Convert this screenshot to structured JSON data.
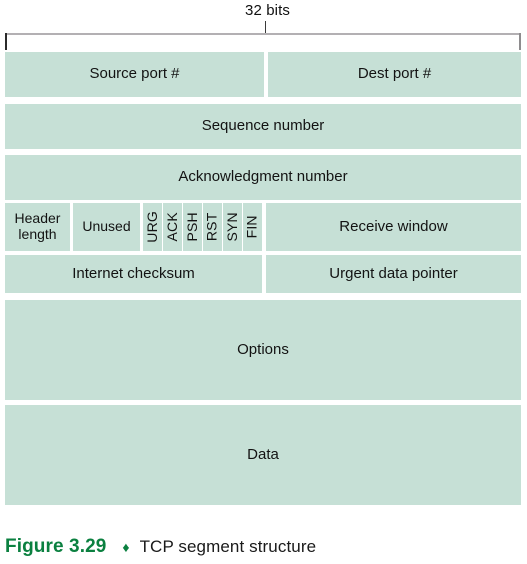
{
  "diagram": {
    "width_label": "32 bits",
    "rows": [
      {
        "name": "ports",
        "cells": [
          {
            "label": "Source port #"
          },
          {
            "label": "Dest port #"
          }
        ]
      },
      {
        "name": "sequence",
        "cells": [
          {
            "label": "Sequence number"
          }
        ]
      },
      {
        "name": "acknowledgment",
        "cells": [
          {
            "label": "Acknowledgment number"
          }
        ]
      },
      {
        "name": "flags",
        "cells": [
          {
            "label": "Header\nlength"
          },
          {
            "label": "Unused"
          },
          {
            "label": "URG"
          },
          {
            "label": "ACK"
          },
          {
            "label": "PSH"
          },
          {
            "label": "RST"
          },
          {
            "label": "SYN"
          },
          {
            "label": "FIN"
          },
          {
            "label": "Receive window"
          }
        ]
      },
      {
        "name": "checksum",
        "cells": [
          {
            "label": "Internet checksum"
          },
          {
            "label": "Urgent data pointer"
          }
        ]
      },
      {
        "name": "options",
        "cells": [
          {
            "label": "Options"
          }
        ]
      },
      {
        "name": "data",
        "cells": [
          {
            "label": "Data"
          }
        ]
      }
    ],
    "field_labels": {
      "source_port": "Source port #",
      "dest_port": "Dest port #",
      "sequence_number": "Sequence number",
      "acknowledgment_number": "Acknowledgment number",
      "header_length_line1": "Header",
      "header_length_line2": "length",
      "unused": "Unused",
      "flag_urg": "URG",
      "flag_ack": "ACK",
      "flag_psh": "PSH",
      "flag_rst": "RST",
      "flag_syn": "SYN",
      "flag_fin": "FIN",
      "receive_window": "Receive window",
      "internet_checksum": "Internet checksum",
      "urgent_data_pointer": "Urgent data pointer",
      "options": "Options",
      "data": "Data"
    }
  },
  "caption": {
    "figure_number": "Figure 3.29",
    "separator": "♦",
    "title": "TCP segment structure"
  },
  "colors": {
    "cell_fill": "#c6e0d6",
    "figure_number_green": "#0b8040",
    "text": "#131313",
    "ruler_gray": "#b3b0b3",
    "background": "#ffffff"
  }
}
